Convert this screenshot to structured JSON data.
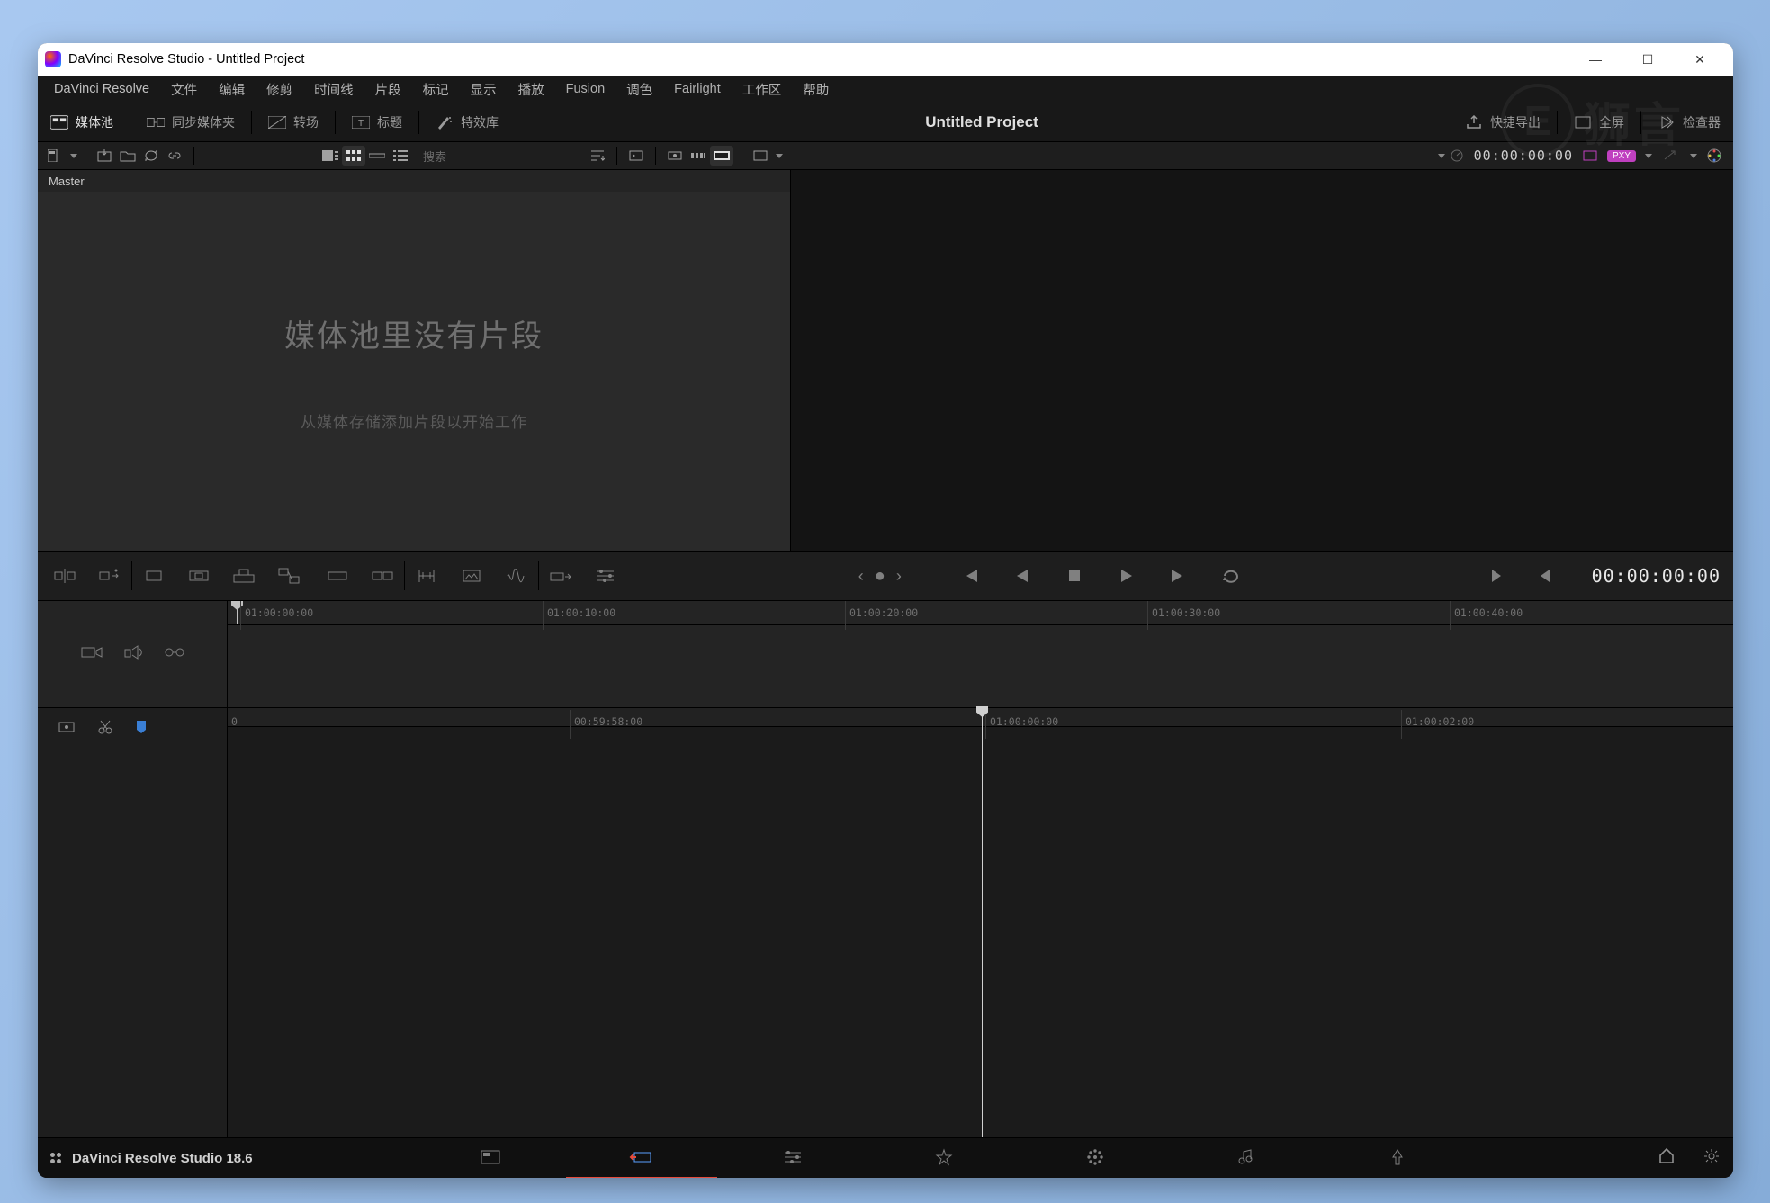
{
  "window": {
    "title": "DaVinci Resolve Studio - Untitled Project"
  },
  "menu": {
    "items": [
      "DaVinci Resolve",
      "文件",
      "编辑",
      "修剪",
      "时间线",
      "片段",
      "标记",
      "显示",
      "播放",
      "Fusion",
      "调色",
      "Fairlight",
      "工作区",
      "帮助"
    ]
  },
  "uibar": {
    "mediapool": "媒体池",
    "sync": "同步媒体夹",
    "transitions": "转场",
    "titles": "标题",
    "effects": "特效库",
    "project_title": "Untitled Project",
    "quick_export": "快捷导出",
    "fullscreen": "全屏",
    "inspector": "检查器"
  },
  "toolbar": {
    "search_placeholder": "搜索",
    "master": "Master",
    "tc": "00:00:00:00"
  },
  "mediapool": {
    "empty_big": "媒体池里没有片段",
    "empty_small": "从媒体存储添加片段以开始工作"
  },
  "transport": {
    "tc": "00:00:00:00"
  },
  "ruler_top": {
    "labels": [
      "01:00:00:00",
      "01:00:10:00",
      "01:00:20:00",
      "01:00:30:00",
      "01:00:40:00"
    ]
  },
  "ruler_bottom": {
    "labels": [
      "00:59:58:00",
      "01:00:00:00",
      "01:00:02:00"
    ]
  },
  "bottombar": {
    "product": "DaVinci Resolve Studio 18.6"
  },
  "watermark": {
    "letter": "E",
    "text": "狮言"
  }
}
